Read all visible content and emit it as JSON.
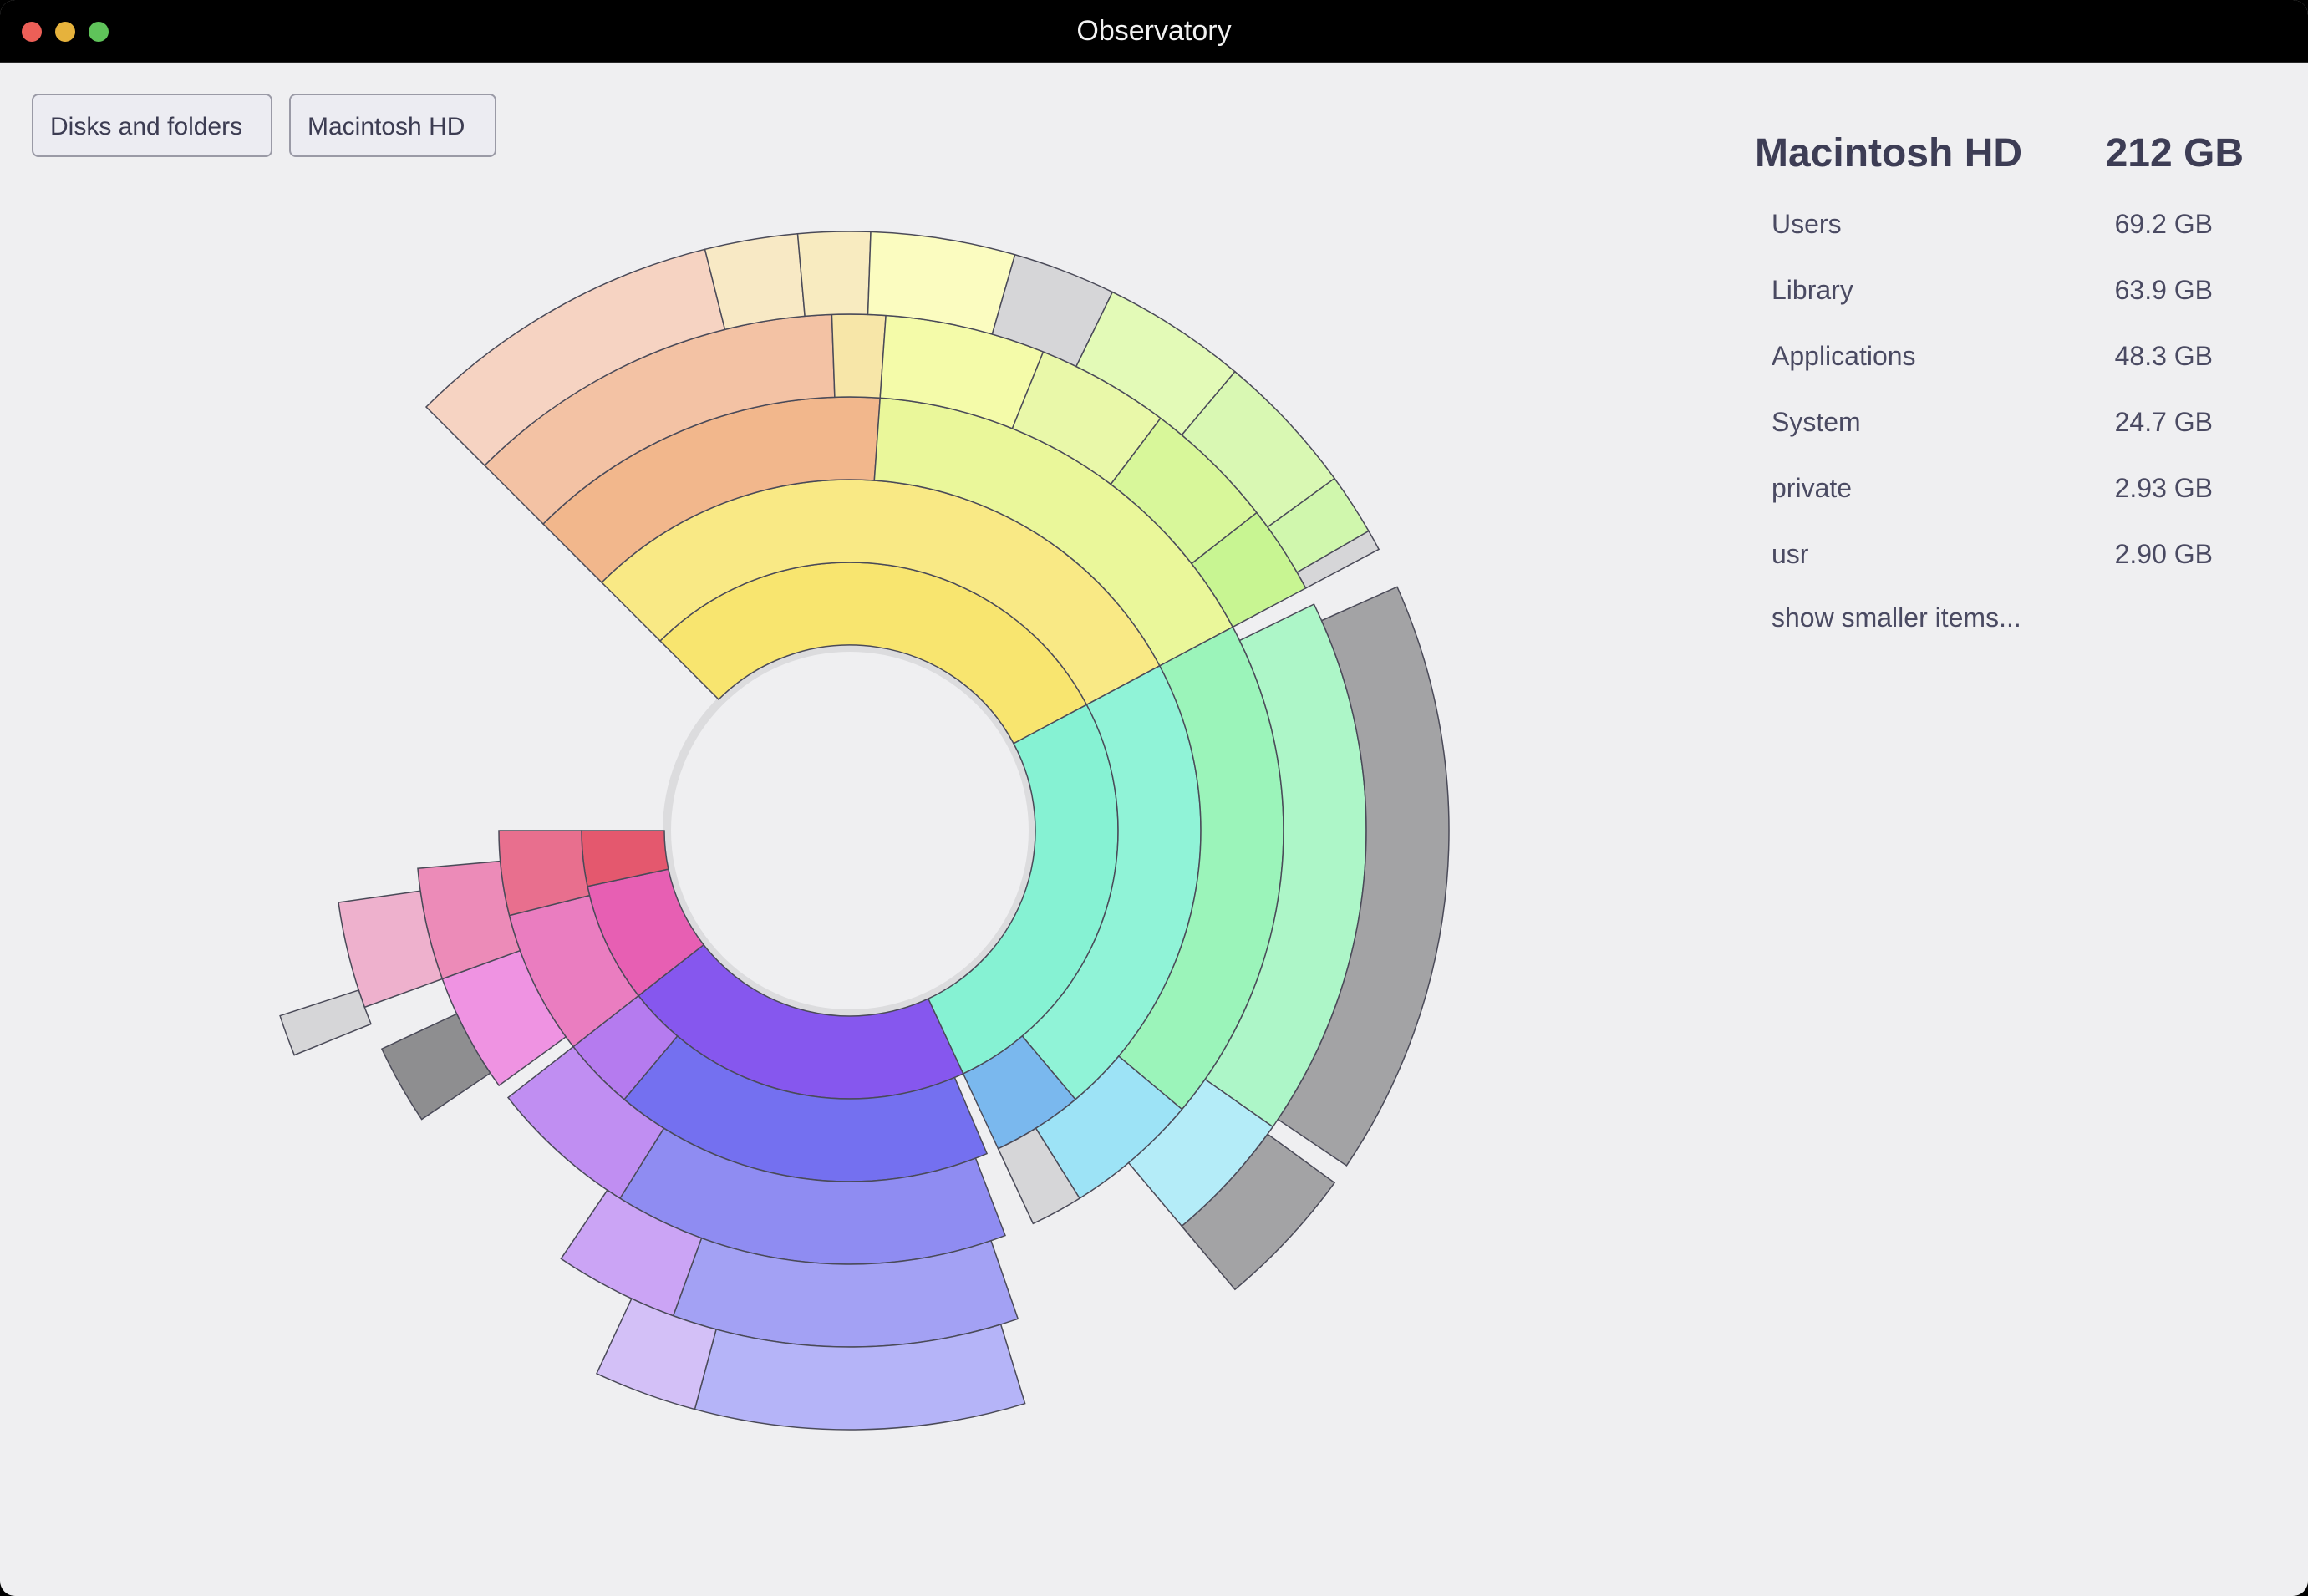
{
  "window": {
    "title": "Observatory",
    "traffic_lights": [
      "close-icon",
      "minimize-icon",
      "zoom-icon"
    ]
  },
  "breadcrumbs": [
    "Disks and folders",
    "Macintosh HD"
  ],
  "summary": {
    "name": "Macintosh HD",
    "size": "212 GB",
    "items": [
      {
        "name": "Users",
        "size": "69.2 GB"
      },
      {
        "name": "Library",
        "size": "63.9 GB"
      },
      {
        "name": "Applications",
        "size": "48.3 GB"
      },
      {
        "name": "System",
        "size": "24.7 GB"
      },
      {
        "name": "private",
        "size": "2.93 GB"
      },
      {
        "name": "usr",
        "size": "2.90 GB"
      }
    ],
    "more_label": "show smaller items..."
  },
  "colors": {
    "users": "#f8e56f",
    "library": "#86f2d3",
    "applications": "#8657ee",
    "system": "#e75fb3",
    "free_space": "#d6d6d8",
    "unlisted": "#a3a3a5"
  }
}
